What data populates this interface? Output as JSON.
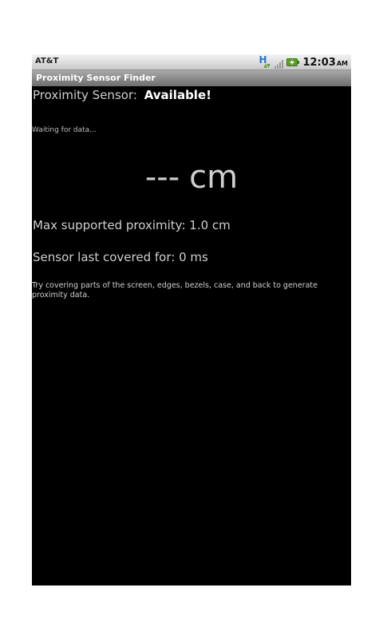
{
  "status_bar": {
    "carrier": "AT&T",
    "network_letter": "H",
    "time": "12:03",
    "ampm": "AM",
    "icons": [
      "hsdpa-icon",
      "signal-strength-icon",
      "battery-charging-icon"
    ]
  },
  "app": {
    "title": "Proximity Sensor Finder"
  },
  "sensor": {
    "label": "Proximity Sensor:",
    "status": "Available!"
  },
  "waiting_text": "Waiting for data...",
  "reading": {
    "value": "---",
    "unit": "cm"
  },
  "max_proximity": "Max supported proximity:  1.0 cm",
  "last_covered": "Sensor last covered for:  0 ms",
  "hint": "Try covering parts of the screen, edges, bezels, case, and back to generate proximity data.",
  "colors": {
    "screen_background": "#000000",
    "text": "#cfcfcf",
    "hsdpa": "#2a78d4",
    "battery": "#5a9e2a"
  }
}
